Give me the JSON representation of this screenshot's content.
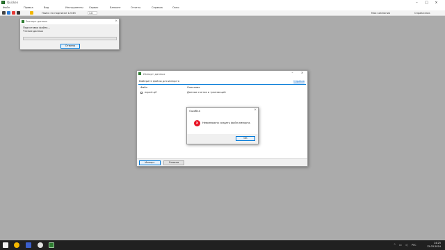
{
  "app": {
    "title": "Quicken",
    "menu": [
      "Файл",
      "Правка",
      "Вид",
      "Инструменты",
      "Сервис",
      "Банкинг",
      "Отчеты",
      "Справка",
      "Окно"
    ],
    "toolbar_label": "Поиск по подписке 12345",
    "toolbar_field": "1.0",
    "right_labels": [
      "Моя компания",
      "Справочник"
    ]
  },
  "progress_dialog": {
    "title": "Экспорт данных",
    "line1": "Подготовка файла...",
    "line2": "Чтение данных",
    "progress": 0.0,
    "cancel_label": "Отмена"
  },
  "main_window": {
    "title": "Импорт данных",
    "subtitle": "Выберите файлы для импорта",
    "help_link": "Справка",
    "col_file": "Файл",
    "col_desc": "Описание",
    "row_file": "export.qif",
    "row_desc": "Данные счетов и транзакций",
    "import_label": "Импорт",
    "cancel_label": "Отмена"
  },
  "error_dialog": {
    "title": "Ошибка",
    "message": "Невозможно создать файл импорта.",
    "ok_label": "OK"
  },
  "taskbar": {
    "time": "14:25",
    "date": "12.03.2024",
    "lang": "РУС"
  },
  "colors": {
    "desktop": "#ababab",
    "accent": "#0078d7",
    "error": "#e81123",
    "taskbar": "#202020"
  }
}
